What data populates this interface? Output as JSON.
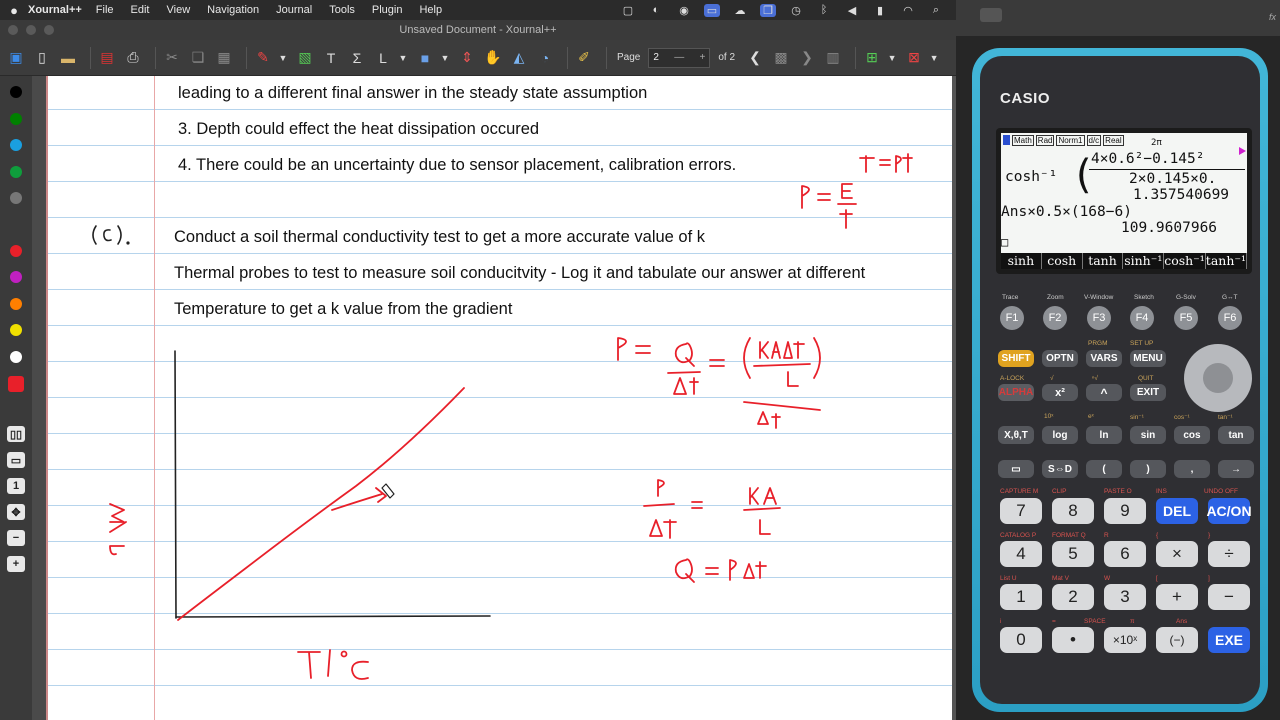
{
  "menubar": {
    "app": "Xournal++",
    "menus": [
      "File",
      "Edit",
      "View",
      "Navigation",
      "Journal",
      "Tools",
      "Plugin",
      "Help"
    ]
  },
  "window": {
    "title": "Unsaved Document - Xournal++"
  },
  "toolbar": {
    "page_label": "Page",
    "page_value": "2",
    "page_of": "of 2",
    "minus": "—",
    "plus": "+"
  },
  "palette": {
    "colors": [
      "#000000",
      "#008000",
      "#1a9fe0",
      "#0f9d3c",
      "#777777",
      "#e8202a",
      "#c020c0",
      "#ff7f00",
      "#f0e000",
      "#ffffff"
    ],
    "selected_color": "#e8202a",
    "zoom_value": "1"
  },
  "document": {
    "lines": [
      "leading to a different final answer in the steady state assumption",
      "3. Depth could effect the heat dissipation occured",
      "4. There could be an uncertainty due to sensor placement, calibration errors.",
      "Conduct a soil thermal conductivity test to get a more accurate value of k",
      "Thermal probes to test to measure soil conducitvity - Log it and tabulate our answer at different",
      "Temperature to get a k value from the gradient"
    ],
    "ink_color": "#e8202a"
  },
  "calculator": {
    "brand": "CASIO",
    "status": [
      "Math",
      "Rad",
      "Norm1",
      "d/c",
      "Real"
    ],
    "display": {
      "top_fragment": "2π",
      "func": "cosh⁻¹",
      "numerator": "4×0.6²−0.145²",
      "denominator": "2×0.145×0.",
      "result1": "1.357540699",
      "expr2": "Ans×0.5×(168−6)",
      "result2": "109.9607966",
      "cursor": "□"
    },
    "fkeys": [
      "sinh",
      "cosh",
      "tanh",
      "sinh⁻¹",
      "cosh⁻¹",
      "tanh⁻¹"
    ],
    "fkey_labels": [
      "Trace",
      "Zoom",
      "V-Window",
      "Sketch",
      "G-Solv",
      "G↔T"
    ],
    "fbuttons": [
      "F1",
      "F2",
      "F3",
      "F4",
      "F5",
      "F6"
    ],
    "row1": [
      "SHIFT",
      "OPTN",
      "VARS",
      "MENU"
    ],
    "row1_top": [
      "",
      "",
      "PRGM",
      "SET UP"
    ],
    "row2": [
      "ALPHA",
      "x²",
      "^",
      "EXIT"
    ],
    "row2_top": [
      "A-LOCK",
      "√",
      "ⁿ√",
      "QUIT"
    ],
    "row3": [
      "X,θ,T",
      "log",
      "ln",
      "sin",
      "cos",
      "tan"
    ],
    "row3_top": [
      "",
      "10ˣ",
      "eˣ",
      "sin⁻¹",
      "cos⁻¹",
      "tan⁻¹"
    ],
    "row4": [
      "▭",
      "S⇔D",
      "(",
      ")",
      ",",
      "→"
    ],
    "num_rows": [
      [
        "7",
        "8",
        "9",
        "DEL",
        "AC/ON"
      ],
      [
        "4",
        "5",
        "6",
        "×",
        "÷"
      ],
      [
        "1",
        "2",
        "3",
        "+",
        "−"
      ],
      [
        "0",
        "•",
        "×10ˣ",
        "(−)",
        "EXE"
      ]
    ],
    "num_row_tops": [
      [
        "CAPTURE M",
        "CLIP",
        "PASTE O",
        "INS",
        "UNDO OFF"
      ],
      [
        "CATALOG P",
        "FORMAT Q",
        "R",
        "{",
        "}"
      ],
      [
        "List U",
        "Mat V",
        "W",
        "[",
        "]"
      ],
      [
        "i",
        "=",
        "SPACE",
        "π",
        "Ans"
      ]
    ]
  }
}
